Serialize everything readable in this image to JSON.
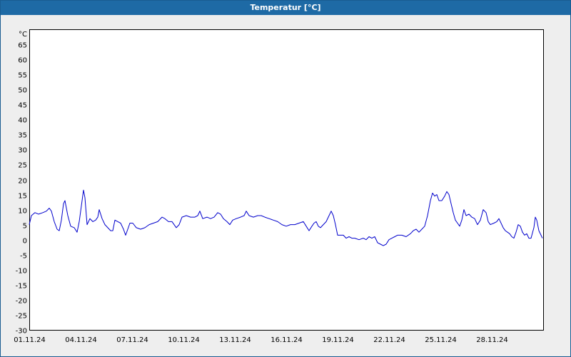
{
  "window": {
    "title": "Temperatur [°C]",
    "colors": {
      "title_bar": "#1e6aa5",
      "title_text": "#ffffff",
      "series": "#0000cc",
      "grid": "#000000",
      "background": "#eeeeee"
    }
  },
  "chart_data": {
    "type": "line",
    "title": "Temperatur [°C]",
    "unit_label": "°C",
    "grid": true,
    "grid_style": "dashed",
    "ylim": [
      -30,
      70
    ],
    "yticks": [
      65,
      60,
      55,
      50,
      45,
      40,
      35,
      30,
      25,
      20,
      15,
      10,
      5,
      0,
      -5,
      -10,
      -15,
      -20,
      -25,
      -30
    ],
    "xlim": [
      "2024-11-01",
      "2024-12-01"
    ],
    "xticks": [
      {
        "date": "2024-11-01",
        "label": "01.11.24"
      },
      {
        "date": "2024-11-04",
        "label": "04.11.24"
      },
      {
        "date": "2024-11-07",
        "label": "07.11.24"
      },
      {
        "date": "2024-11-10",
        "label": "10.11.24"
      },
      {
        "date": "2024-11-13",
        "label": "13.11.24"
      },
      {
        "date": "2024-11-16",
        "label": "16.11.24"
      },
      {
        "date": "2024-11-19",
        "label": "19.11.24"
      },
      {
        "date": "2024-11-22",
        "label": "22.11.24"
      },
      {
        "date": "2024-11-25",
        "label": "25.11.24"
      },
      {
        "date": "2024-11-28",
        "label": "28.11.24"
      }
    ],
    "series": [
      {
        "color": "#0000cc",
        "points": [
          [
            "2024-11-01 00:00",
            5.0
          ],
          [
            "2024-11-01 03:00",
            8.0
          ],
          [
            "2024-11-01 08:00",
            9.0
          ],
          [
            "2024-11-01 13:00",
            8.5
          ],
          [
            "2024-11-01 19:00",
            9.0
          ],
          [
            "2024-11-02 00:00",
            9.5
          ],
          [
            "2024-11-02 04:00",
            10.5
          ],
          [
            "2024-11-02 07:00",
            9.5
          ],
          [
            "2024-11-02 11:00",
            6.0
          ],
          [
            "2024-11-02 15:00",
            3.5
          ],
          [
            "2024-11-02 18:00",
            3.0
          ],
          [
            "2024-11-02 21:00",
            6.5
          ],
          [
            "2024-11-03 00:00",
            12.0
          ],
          [
            "2024-11-03 02:00",
            13.0
          ],
          [
            "2024-11-03 06:00",
            8.0
          ],
          [
            "2024-11-03 10:00",
            4.5
          ],
          [
            "2024-11-03 15:00",
            4.0
          ],
          [
            "2024-11-03 19:00",
            2.5
          ],
          [
            "2024-11-03 22:00",
            6.0
          ],
          [
            "2024-11-04 02:00",
            13.0
          ],
          [
            "2024-11-04 04:00",
            16.5
          ],
          [
            "2024-11-04 06:00",
            14.0
          ],
          [
            "2024-11-04 09:00",
            5.0
          ],
          [
            "2024-11-04 13:00",
            7.0
          ],
          [
            "2024-11-04 17:00",
            6.0
          ],
          [
            "2024-11-04 21:00",
            6.5
          ],
          [
            "2024-11-05 00:00",
            7.5
          ],
          [
            "2024-11-05 02:00",
            10.0
          ],
          [
            "2024-11-05 06:00",
            7.0
          ],
          [
            "2024-11-05 10:00",
            5.0
          ],
          [
            "2024-11-05 14:00",
            4.0
          ],
          [
            "2024-11-05 18:00",
            3.0
          ],
          [
            "2024-11-05 21:00",
            3.0
          ],
          [
            "2024-11-06 00:00",
            6.5
          ],
          [
            "2024-11-06 04:00",
            6.0
          ],
          [
            "2024-11-06 08:00",
            5.5
          ],
          [
            "2024-11-06 12:00",
            3.5
          ],
          [
            "2024-11-06 15:00",
            1.5
          ],
          [
            "2024-11-06 18:00",
            3.5
          ],
          [
            "2024-11-06 21:00",
            5.5
          ],
          [
            "2024-11-07 01:00",
            5.5
          ],
          [
            "2024-11-07 06:00",
            4.0
          ],
          [
            "2024-11-07 12:00",
            3.5
          ],
          [
            "2024-11-07 18:00",
            4.0
          ],
          [
            "2024-11-08 00:00",
            5.0
          ],
          [
            "2024-11-08 06:00",
            5.5
          ],
          [
            "2024-11-08 12:00",
            6.0
          ],
          [
            "2024-11-08 18:00",
            7.5
          ],
          [
            "2024-11-08 22:00",
            7.0
          ],
          [
            "2024-11-09 03:00",
            6.0
          ],
          [
            "2024-11-09 08:00",
            6.0
          ],
          [
            "2024-11-09 14:00",
            4.0
          ],
          [
            "2024-11-09 18:00",
            5.0
          ],
          [
            "2024-11-09 22:00",
            7.5
          ],
          [
            "2024-11-10 04:00",
            8.0
          ],
          [
            "2024-11-10 10:00",
            7.5
          ],
          [
            "2024-11-10 16:00",
            7.5
          ],
          [
            "2024-11-10 20:00",
            8.0
          ],
          [
            "2024-11-10 23:00",
            9.5
          ],
          [
            "2024-11-11 03:00",
            7.0
          ],
          [
            "2024-11-11 09:00",
            7.5
          ],
          [
            "2024-11-11 14:00",
            7.0
          ],
          [
            "2024-11-11 19:00",
            7.5
          ],
          [
            "2024-11-12 00:00",
            9.0
          ],
          [
            "2024-11-12 04:00",
            8.5
          ],
          [
            "2024-11-12 08:00",
            7.0
          ],
          [
            "2024-11-12 13:00",
            6.0
          ],
          [
            "2024-11-12 17:00",
            5.0
          ],
          [
            "2024-11-12 21:00",
            6.5
          ],
          [
            "2024-11-13 02:00",
            7.0
          ],
          [
            "2024-11-13 08:00",
            7.5
          ],
          [
            "2024-11-13 13:00",
            8.0
          ],
          [
            "2024-11-13 16:00",
            9.5
          ],
          [
            "2024-11-13 20:00",
            8.0
          ],
          [
            "2024-11-14 02:00",
            7.5
          ],
          [
            "2024-11-14 08:00",
            8.0
          ],
          [
            "2024-11-14 13:00",
            8.0
          ],
          [
            "2024-11-14 18:00",
            7.5
          ],
          [
            "2024-11-15 00:00",
            7.0
          ],
          [
            "2024-11-15 06:00",
            6.5
          ],
          [
            "2024-11-15 12:00",
            6.0
          ],
          [
            "2024-11-15 18:00",
            5.0
          ],
          [
            "2024-11-16 00:00",
            4.5
          ],
          [
            "2024-11-16 06:00",
            5.0
          ],
          [
            "2024-11-16 12:00",
            5.0
          ],
          [
            "2024-11-16 18:00",
            5.5
          ],
          [
            "2024-11-17 00:00",
            6.0
          ],
          [
            "2024-11-17 04:00",
            4.5
          ],
          [
            "2024-11-17 08:00",
            3.0
          ],
          [
            "2024-11-17 12:00",
            4.5
          ],
          [
            "2024-11-17 15:00",
            5.5
          ],
          [
            "2024-11-17 18:00",
            6.0
          ],
          [
            "2024-11-17 21:00",
            4.5
          ],
          [
            "2024-11-18 00:00",
            4.0
          ],
          [
            "2024-11-18 04:00",
            5.0
          ],
          [
            "2024-11-18 08:00",
            6.0
          ],
          [
            "2024-11-18 12:00",
            8.0
          ],
          [
            "2024-11-18 15:00",
            9.5
          ],
          [
            "2024-11-18 18:00",
            8.0
          ],
          [
            "2024-11-18 21:00",
            5.0
          ],
          [
            "2024-11-19 00:00",
            1.5
          ],
          [
            "2024-11-19 04:00",
            1.5
          ],
          [
            "2024-11-19 08:00",
            1.5
          ],
          [
            "2024-11-19 12:00",
            0.5
          ],
          [
            "2024-11-19 16:00",
            1.0
          ],
          [
            "2024-11-19 20:00",
            0.5
          ],
          [
            "2024-11-20 00:00",
            0.5
          ],
          [
            "2024-11-20 06:00",
            0.0
          ],
          [
            "2024-11-20 12:00",
            0.5
          ],
          [
            "2024-11-20 16:00",
            0.0
          ],
          [
            "2024-11-20 20:00",
            1.0
          ],
          [
            "2024-11-21 00:00",
            0.5
          ],
          [
            "2024-11-21 04:00",
            1.0
          ],
          [
            "2024-11-21 08:00",
            -1.0
          ],
          [
            "2024-11-21 12:00",
            -1.5
          ],
          [
            "2024-11-21 16:00",
            -2.0
          ],
          [
            "2024-11-21 20:00",
            -1.5
          ],
          [
            "2024-11-22 00:00",
            0.0
          ],
          [
            "2024-11-22 04:00",
            0.5
          ],
          [
            "2024-11-22 08:00",
            1.0
          ],
          [
            "2024-11-22 12:00",
            1.5
          ],
          [
            "2024-11-22 18:00",
            1.5
          ],
          [
            "2024-11-23 00:00",
            1.0
          ],
          [
            "2024-11-23 06:00",
            2.0
          ],
          [
            "2024-11-23 10:00",
            3.0
          ],
          [
            "2024-11-23 14:00",
            3.5
          ],
          [
            "2024-11-23 18:00",
            2.5
          ],
          [
            "2024-11-23 22:00",
            3.5
          ],
          [
            "2024-11-24 02:00",
            4.5
          ],
          [
            "2024-11-24 06:00",
            8.0
          ],
          [
            "2024-11-24 10:00",
            13.0
          ],
          [
            "2024-11-24 13:00",
            15.5
          ],
          [
            "2024-11-24 16:00",
            14.5
          ],
          [
            "2024-11-24 19:00",
            15.0
          ],
          [
            "2024-11-24 22:00",
            13.0
          ],
          [
            "2024-11-25 02:00",
            13.0
          ],
          [
            "2024-11-25 06:00",
            14.5
          ],
          [
            "2024-11-25 09:00",
            16.0
          ],
          [
            "2024-11-25 12:00",
            15.0
          ],
          [
            "2024-11-25 15:00",
            12.0
          ],
          [
            "2024-11-25 18:00",
            9.0
          ],
          [
            "2024-11-25 21:00",
            6.5
          ],
          [
            "2024-11-26 00:00",
            5.5
          ],
          [
            "2024-11-26 03:00",
            4.5
          ],
          [
            "2024-11-26 06:00",
            6.5
          ],
          [
            "2024-11-26 09:00",
            10.0
          ],
          [
            "2024-11-26 12:00",
            8.0
          ],
          [
            "2024-11-26 16:00",
            8.5
          ],
          [
            "2024-11-26 20:00",
            7.5
          ],
          [
            "2024-11-27 00:00",
            7.0
          ],
          [
            "2024-11-27 04:00",
            5.0
          ],
          [
            "2024-11-27 08:00",
            6.5
          ],
          [
            "2024-11-27 12:00",
            10.0
          ],
          [
            "2024-11-27 16:00",
            9.0
          ],
          [
            "2024-11-27 19:00",
            6.0
          ],
          [
            "2024-11-27 22:00",
            5.0
          ],
          [
            "2024-11-28 03:00",
            5.5
          ],
          [
            "2024-11-28 07:00",
            6.0
          ],
          [
            "2024-11-28 10:00",
            7.0
          ],
          [
            "2024-11-28 13:00",
            5.5
          ],
          [
            "2024-11-28 16:00",
            4.0
          ],
          [
            "2024-11-28 19:00",
            3.0
          ],
          [
            "2024-11-28 22:00",
            2.5
          ],
          [
            "2024-11-29 01:00",
            2.0
          ],
          [
            "2024-11-29 04:00",
            1.0
          ],
          [
            "2024-11-29 07:00",
            0.5
          ],
          [
            "2024-11-29 10:00",
            2.5
          ],
          [
            "2024-11-29 13:00",
            5.0
          ],
          [
            "2024-11-29 16:00",
            4.5
          ],
          [
            "2024-11-29 19:00",
            2.5
          ],
          [
            "2024-11-29 22:00",
            1.5
          ],
          [
            "2024-11-30 01:00",
            2.0
          ],
          [
            "2024-11-30 04:00",
            0.5
          ],
          [
            "2024-11-30 07:00",
            0.5
          ],
          [
            "2024-11-30 11:00",
            4.0
          ],
          [
            "2024-11-30 13:00",
            7.5
          ],
          [
            "2024-11-30 15:00",
            6.5
          ],
          [
            "2024-11-30 18:00",
            3.0
          ],
          [
            "2024-11-30 21:00",
            1.5
          ],
          [
            "2024-11-30 23:00",
            0.5
          ]
        ]
      }
    ]
  }
}
